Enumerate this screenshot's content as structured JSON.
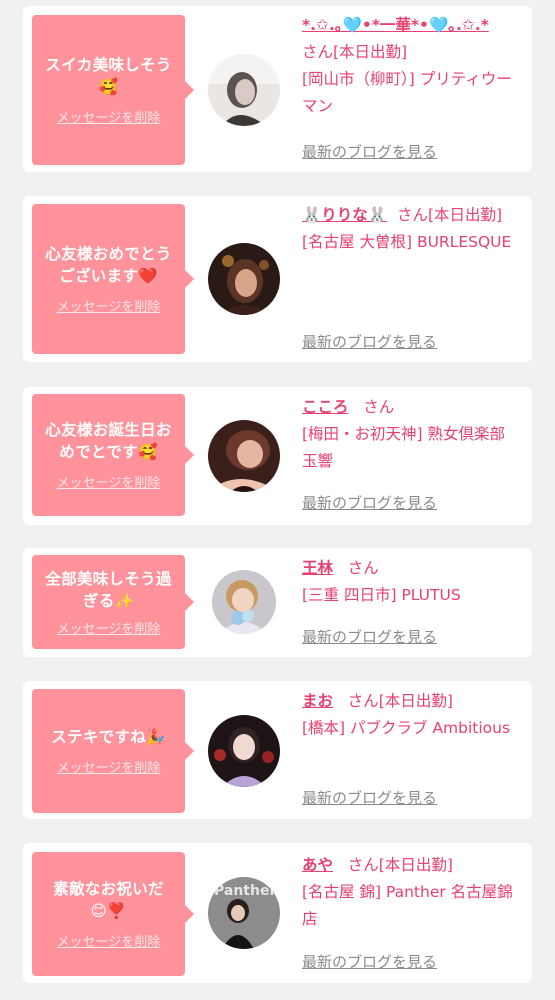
{
  "colors": {
    "page_bg": "#f1f1f1",
    "bubble_bg": "#ff929b",
    "accent": "#e8406f",
    "link_gray": "#8a8a8a"
  },
  "items": [
    {
      "message_line1": "スイカ美味しそう",
      "message_emoji": "🥰",
      "delete_label": "メッセージを削除",
      "name": "*.✩.｡🩵•*一華*•🩵｡.✩.*",
      "suffix": "さん[本日出勤]",
      "shop": "[岡山市（柳町）] プリティウーマン",
      "blog_label": "最新のブログを見る",
      "avatar_icon": "woman-portrait-icon"
    },
    {
      "message_line1": "心友様おめでとうございます",
      "message_emoji": "❤️",
      "delete_label": "メッセージを削除",
      "name": "🐰りりな🐰",
      "suffix": "さん[本日出勤]",
      "shop": "[名古屋 大曽根] BURLESQUE",
      "blog_label": "最新のブログを見る",
      "avatar_icon": "woman-portrait-icon"
    },
    {
      "message_line1": "心友様お誕生日おめでとです",
      "message_emoji": "🥰",
      "delete_label": "メッセージを削除",
      "name": "こころ",
      "suffix": "さん",
      "shop": "[梅田・お初天神] 熟女倶楽部 玉響",
      "blog_label": "最新のブログを見る",
      "avatar_icon": "woman-portrait-icon"
    },
    {
      "message_line1": "全部美味しそう過ぎる",
      "message_emoji": "✨",
      "delete_label": "メッセージを削除",
      "name": "王林",
      "suffix": "さん",
      "shop": "[三重 四日市] PLUTUS",
      "blog_label": "最新のブログを見る",
      "avatar_icon": "woman-portrait-icon"
    },
    {
      "message_line1": "ステキですね",
      "message_emoji": "🎉",
      "delete_label": "メッセージを削除",
      "name": "まお",
      "suffix": "さん[本日出勤]",
      "shop": "[橋本] パブクラブ Ambitious",
      "blog_label": "最新のブログを見る",
      "avatar_icon": "woman-portrait-icon"
    },
    {
      "message_line1": "素敵なお祝いだ",
      "message_emoji": "😊❣️",
      "delete_label": "メッセージを削除",
      "name": "あや",
      "suffix": "さん[本日出勤]",
      "shop": "[名古屋 錦] Panther 名古屋錦店",
      "blog_label": "最新のブログを見る",
      "avatar_icon": "woman-portrait-icon",
      "avatar_text": "Panther"
    }
  ]
}
